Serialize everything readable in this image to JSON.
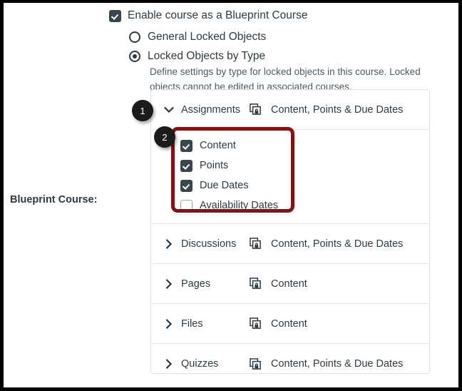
{
  "page": {
    "side_label": "Blueprint Course:"
  },
  "master_checkbox": {
    "label": "Enable course as a Blueprint Course",
    "checked": true
  },
  "radios": [
    {
      "label": "General Locked Objects",
      "selected": false
    },
    {
      "label": "Locked Objects by Type",
      "selected": true
    }
  ],
  "description": "Define settings by type for locked objects in this course. Locked objects cannot be edited in associated courses.",
  "accordion": {
    "rows": [
      {
        "name": "Assignments",
        "settings": "Content, Points & Due Dates",
        "expanded": true,
        "chevron": "chevron-down-icon",
        "lock_icon": "blueprint-lock-icon",
        "options": [
          {
            "label": "Content",
            "checked": true
          },
          {
            "label": "Points",
            "checked": true
          },
          {
            "label": "Due Dates",
            "checked": true
          },
          {
            "label": "Availability Dates",
            "checked": false
          }
        ]
      },
      {
        "name": "Discussions",
        "settings": "Content, Points & Due Dates",
        "expanded": false,
        "chevron": "chevron-right-icon",
        "lock_icon": "blueprint-lock-icon"
      },
      {
        "name": "Pages",
        "settings": "Content",
        "expanded": false,
        "chevron": "chevron-right-icon",
        "lock_icon": "blueprint-lock-icon"
      },
      {
        "name": "Files",
        "settings": "Content",
        "expanded": false,
        "chevron": "chevron-right-icon",
        "lock_icon": "blueprint-lock-icon"
      },
      {
        "name": "Quizzes",
        "settings": "Content, Points & Due Dates",
        "expanded": false,
        "chevron": "chevron-right-icon",
        "lock_icon": "blueprint-lock-icon"
      }
    ]
  },
  "annotations": {
    "badges": [
      {
        "number": "1"
      },
      {
        "number": "2"
      }
    ],
    "highlight_color": "#8B1014"
  },
  "colors": {
    "text": "#2D3B45",
    "checkbox_fill": "#37474F",
    "panel_border": "#dfe3e6",
    "badge_bg": "#1b1b1b"
  }
}
